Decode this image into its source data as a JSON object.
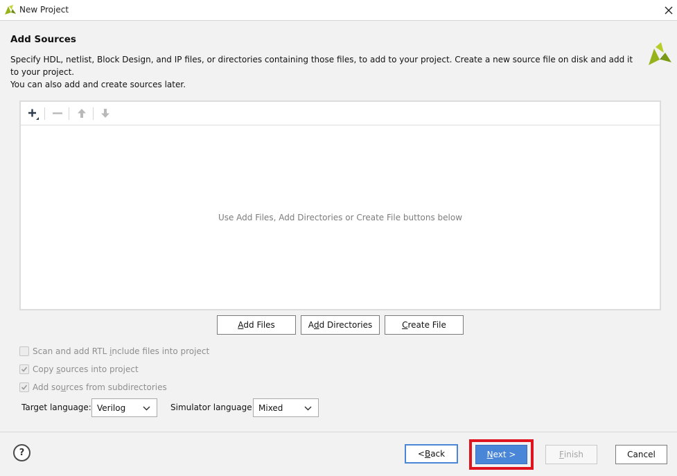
{
  "window": {
    "title": "New Project",
    "app_icon": "vivado-logo-icon",
    "close_icon": "close-icon"
  },
  "page": {
    "heading": "Add Sources",
    "description_line1": "Specify HDL, netlist, Block Design, and IP files, or directories containing those files, to add to your project. Create a new source file on disk and add it to your project.",
    "description_line2": "You can also add and create sources later."
  },
  "source_panel": {
    "toolbar": {
      "add_icon": "plus-icon",
      "remove_icon": "minus-icon",
      "up_icon": "arrow-up-icon",
      "down_icon": "arrow-down-icon"
    },
    "empty_hint": "Use Add Files, Add Directories or Create File buttons below"
  },
  "actions": {
    "add_files": {
      "pre": "",
      "key": "A",
      "post": "dd Files"
    },
    "add_directories": {
      "pre": "A",
      "key": "d",
      "post": "d Directories"
    },
    "create_file": {
      "pre": "",
      "key": "C",
      "post": "reate File"
    }
  },
  "options": {
    "scan_rtl": {
      "pre": "Scan and add RTL ",
      "key": "i",
      "post": "nclude files into project",
      "checked": false
    },
    "copy_sources": {
      "pre": "Copy ",
      "key": "s",
      "post": "ources into project",
      "checked": true
    },
    "add_subdirs": {
      "pre": "Add so",
      "key": "u",
      "post": "rces from subdirectories",
      "checked": true
    }
  },
  "languages": {
    "target_label": "Target language:",
    "target_value": "Verilog",
    "simulator_label": "Simulator language:",
    "simulator_value": "Mixed"
  },
  "footer": {
    "help_label": "?",
    "back": {
      "pre": "< ",
      "key": "B",
      "post": "ack"
    },
    "next": {
      "pre": "",
      "key": "N",
      "post": "ext >"
    },
    "finish": {
      "pre": "",
      "key": "F",
      "post": "inish"
    },
    "cancel": "Cancel"
  },
  "colors": {
    "accent_blue": "#4a86d8",
    "highlight_red": "#e0141e",
    "logo_green": "#97b31b",
    "disabled_text": "#8e8e8e"
  }
}
